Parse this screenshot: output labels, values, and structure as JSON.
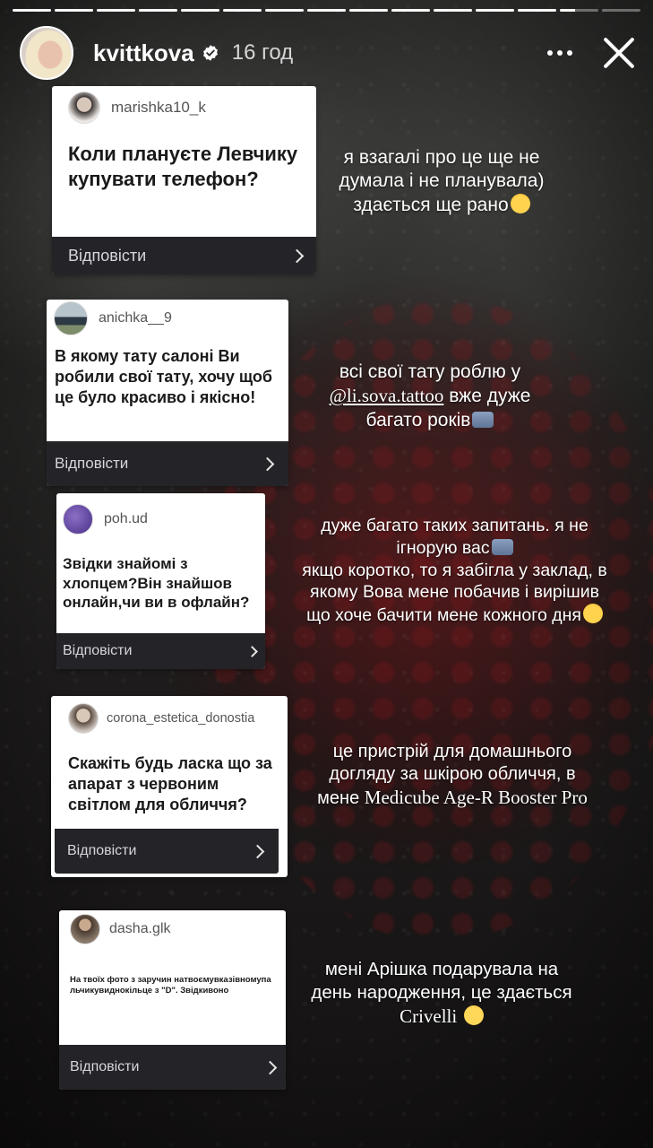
{
  "story": {
    "progress": {
      "segments": 15,
      "active_index": 13,
      "active_fill": 0.4
    },
    "author": {
      "username": "kvittkova",
      "verified": true,
      "time": "16 год"
    },
    "reply_label": "Відповісти",
    "items": [
      {
        "question_user": "marishka10_k",
        "question": "Коли плануєте Левчику купувати телефон?",
        "answer_lines": [
          "я взагалі про це ще не",
          "думала і не планувала)",
          "здається ще рано"
        ]
      },
      {
        "question_user": "anichka__9",
        "question": "В якому тату салоні Ви робили свої тату, хочу щоб це було красиво і якісно!",
        "answer_lines": [
          "всі свої тату роблю у",
          "вже дуже",
          "багато років"
        ],
        "mention": "@li.sova.tattoo"
      },
      {
        "question_user": "poh.ud",
        "question": "Звідки знайомі з хлопцем?Він знайшов онлайн,чи ви в офлайн?",
        "answer_lines": [
          "дуже багато таких запитань. я не",
          "ігнорую вас",
          "якщо коротко, то я забігла у заклад, в",
          "якому Вова мене побачив і вирішив",
          "що хоче бачити мене кожного дня"
        ]
      },
      {
        "question_user": "corona_estetica_donostia",
        "question": "Скажіть будь ласка що за апарат з червоним світлом для обличчя?",
        "answer_lines": [
          "це пристрій для домашнього",
          "догляду за шкірою обличчя, в",
          "мене"
        ],
        "product": "Medicube Age-R Booster Pro"
      },
      {
        "question_user": "dasha.glk",
        "question": "На твоїх фото з заручин натвоємувказівномупальчикувиднокільце з \"D\". Звідкивоно",
        "answer_lines": [
          "мені Арішка подарувала на",
          "день народження, це здається"
        ],
        "brand": "Crivelli"
      }
    ]
  },
  "colors": {
    "reply_bar": "#242428",
    "card": "#ffffff",
    "text": "#ffffff"
  },
  "icons": {
    "verified": "verified-badge-icon",
    "more": "more-dots-icon",
    "close": "close-icon",
    "chevron": "chevron-right-icon"
  }
}
